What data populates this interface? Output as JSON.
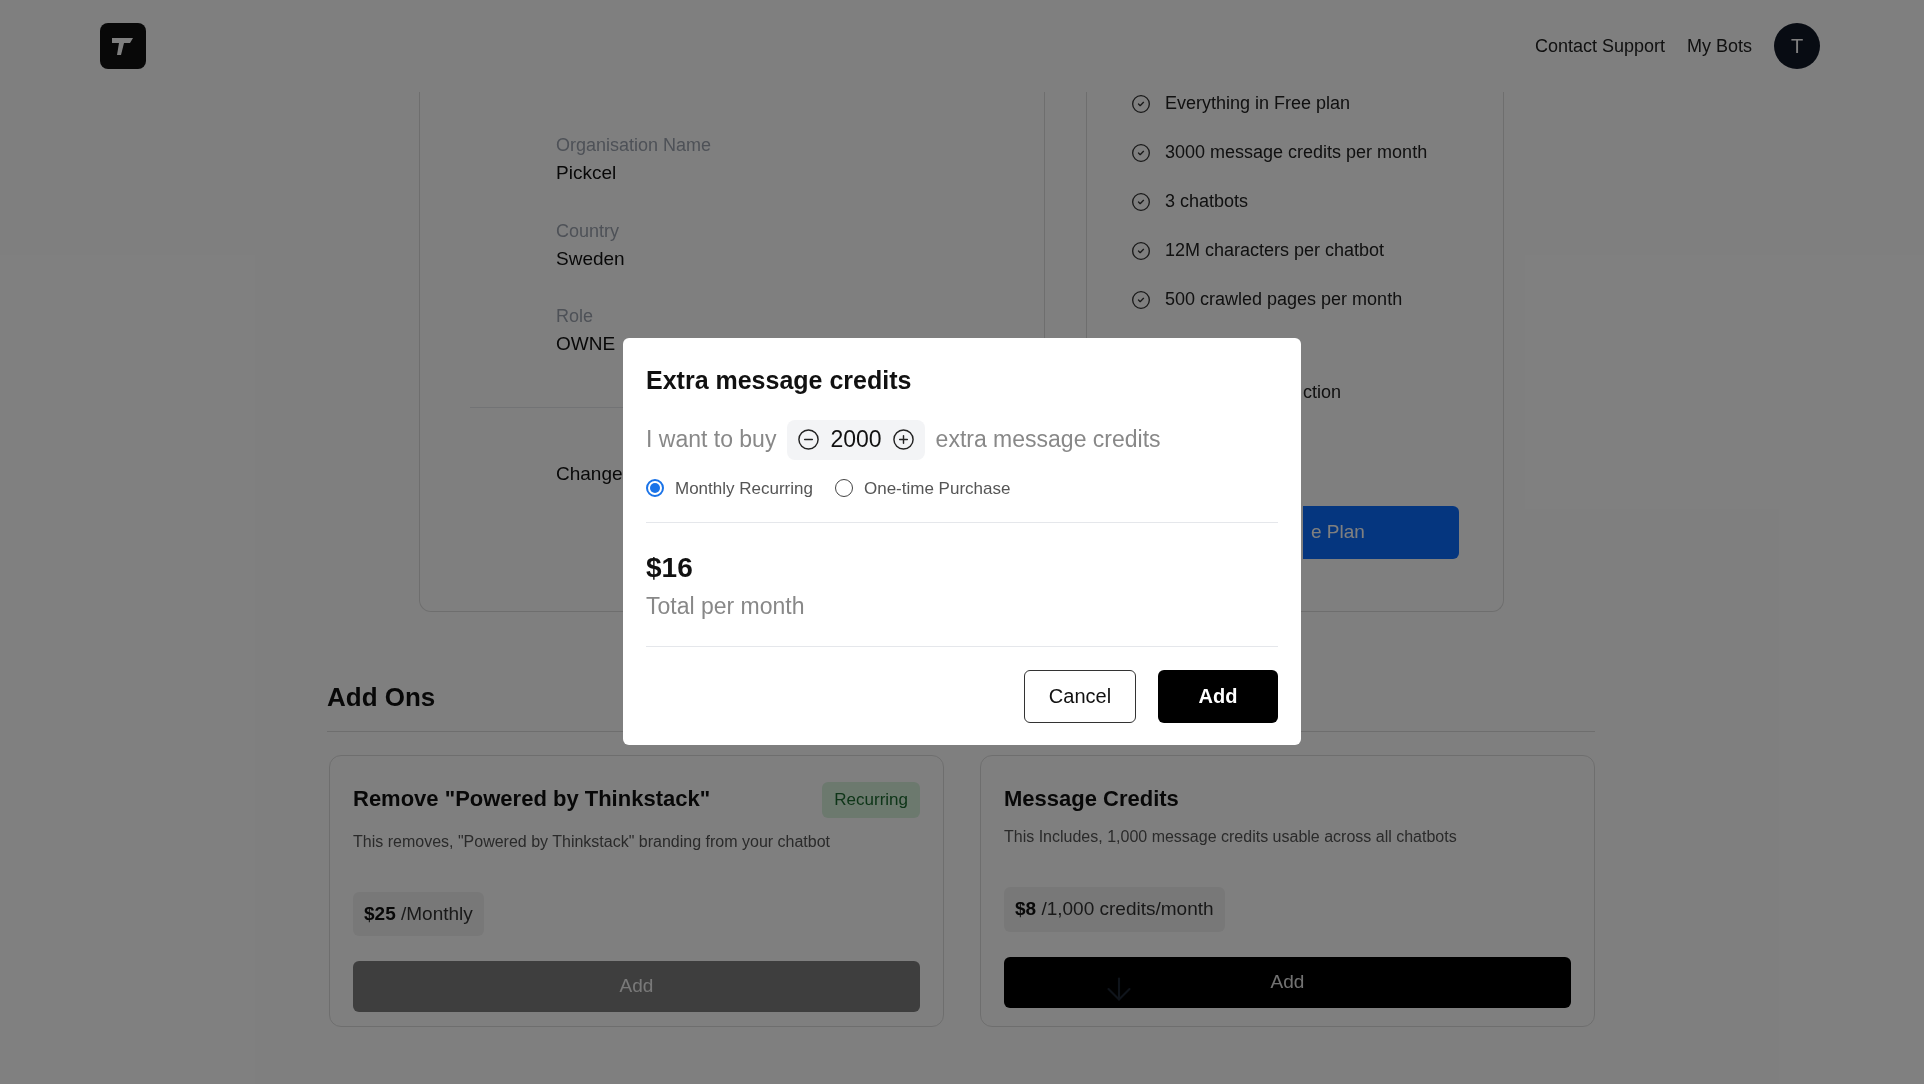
{
  "header": {
    "links": [
      "Contact Support",
      "My Bots"
    ],
    "avatar_initial": "T"
  },
  "account_card": {
    "fields": [
      {
        "label": "Organisation Name",
        "value": "Pickcel"
      },
      {
        "label": "Country",
        "value": "Sweden"
      },
      {
        "label": "Role",
        "value": "OWNE"
      }
    ],
    "link": "Change"
  },
  "plan_card": {
    "features": [
      "Everything in Free plan",
      "3000 message credits per month",
      "3 chatbots",
      "12M characters per chatbot",
      "500 crawled pages per month"
    ],
    "covered_feature": "ction",
    "button": "e Plan"
  },
  "add_ons": {
    "title": "Add Ons",
    "items": [
      {
        "title": "Remove \"Powered by Thinkstack\"",
        "badge": "Recurring",
        "description": "This removes, \"Powered by Thinkstack\" branding from your chatbot",
        "price": "$25",
        "unit": "/Monthly",
        "button": "Add",
        "disabled": true
      },
      {
        "title": "Message Credits",
        "description": "This Includes, 1,000 message credits usable across all chatbots",
        "price": "$8",
        "unit": "/1,000 credits/month",
        "button": "Add",
        "disabled": false
      }
    ]
  },
  "modal": {
    "title": "Extra message credits",
    "prefix": "I want to buy",
    "quantity": "2000",
    "suffix": "extra message credits",
    "options": [
      {
        "label": "Monthly Recurring",
        "selected": true
      },
      {
        "label": "One-time Purchase",
        "selected": false
      }
    ],
    "total": "$16",
    "total_label": "Total per month",
    "buttons": [
      {
        "label": "Cancel",
        "kind": "secondary"
      },
      {
        "label": "Add",
        "kind": "primary"
      }
    ]
  }
}
